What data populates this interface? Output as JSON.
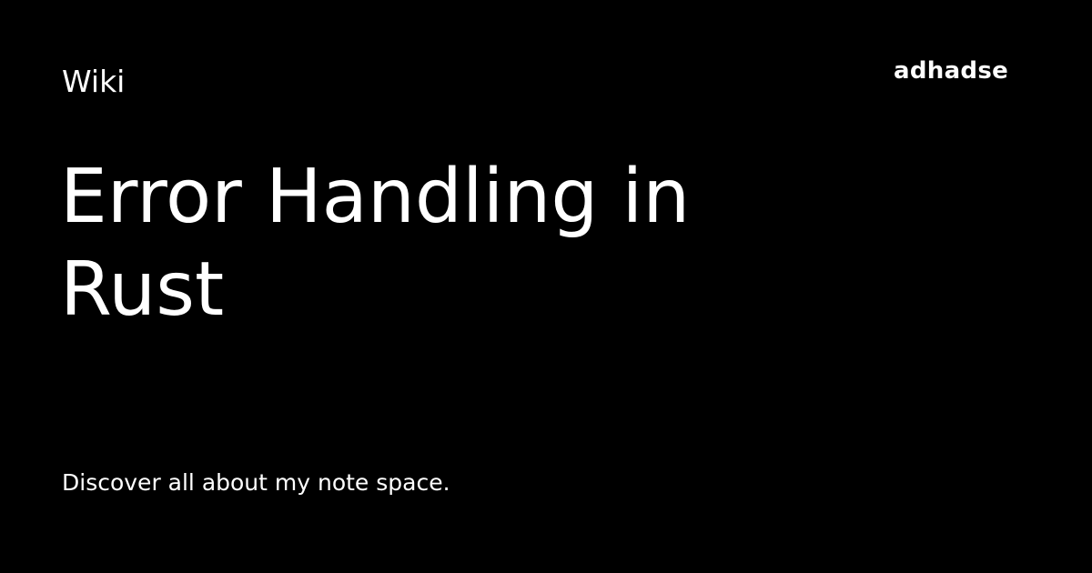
{
  "header": {
    "category": "Wiki",
    "brand": "adhadse"
  },
  "main": {
    "title_lines": [
      "Error Handling in",
      "Rust"
    ]
  },
  "footer": {
    "description": "Discover all about my note space."
  },
  "colors": {
    "background": "#000000",
    "text": "#ffffff"
  }
}
